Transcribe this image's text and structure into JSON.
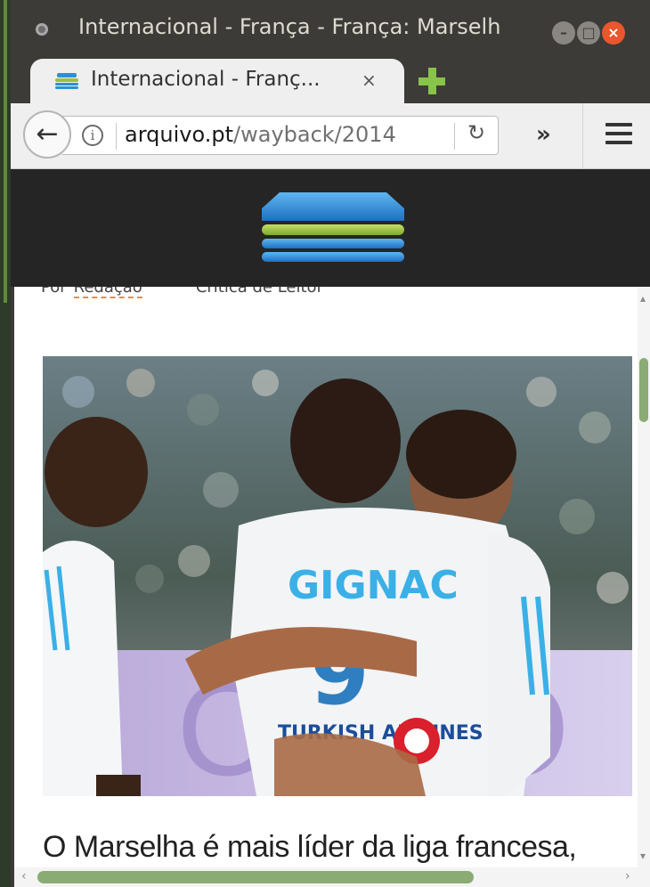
{
  "window": {
    "title": "Internacional - França - França: Marselh"
  },
  "tab": {
    "title": "Internacional - Franç...",
    "close": "×",
    "new_tab": "+"
  },
  "navbar": {
    "back": "🡐",
    "info": "i",
    "url_host": "arquivo.pt",
    "url_path": "/wayback/2014",
    "reload": "↻",
    "overflow": "»"
  },
  "article": {
    "byline_prefix": "Por",
    "byline_author": "Redação",
    "byline_date": "Crítica de Leitor",
    "photo": {
      "jersey_name": "GIGNAC",
      "jersey_number": "9",
      "sponsor": "TURKISH AIRLINES"
    },
    "headline": "O Marselha é mais líder da liga francesa,"
  },
  "scroll": {
    "vertical_position": 0.12,
    "horizontal_position": 0.02
  },
  "colors": {
    "accent_green": "#88c449",
    "logo_blue": "#2f8fd6",
    "logo_green": "#9ac33d",
    "header_bg": "#252525",
    "close_orange": "#e8572d"
  }
}
